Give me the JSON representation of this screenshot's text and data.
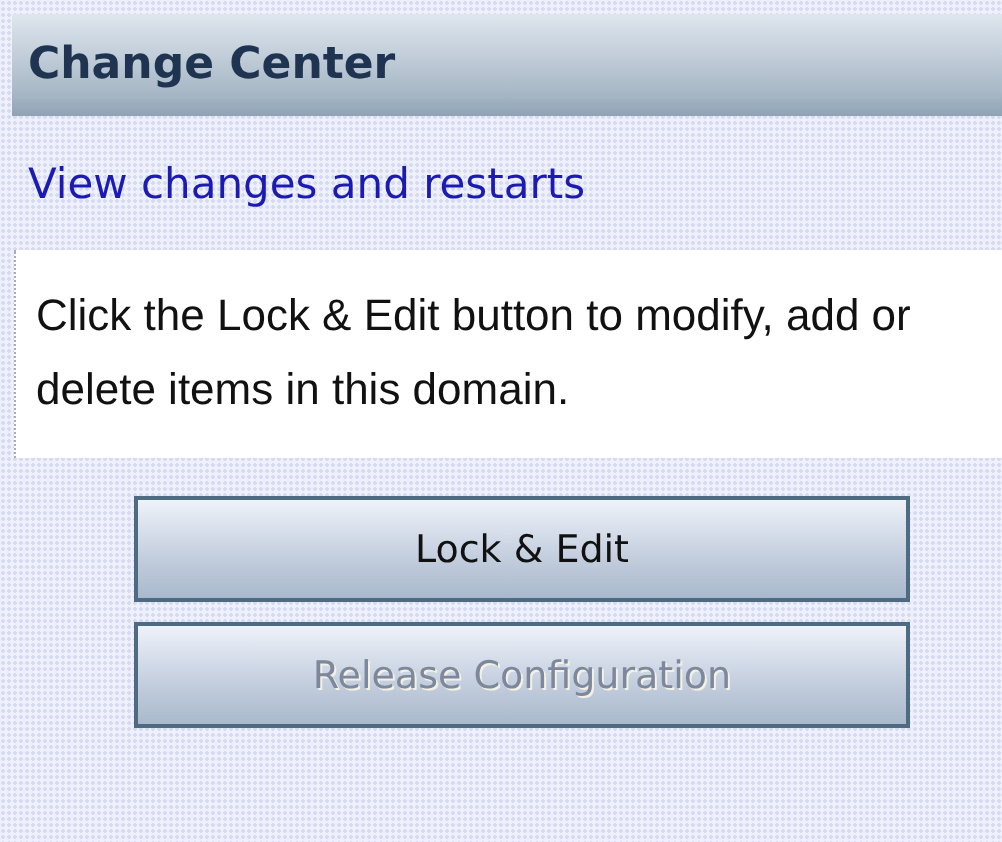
{
  "panel": {
    "title": "Change Center"
  },
  "link": "View changes and restarts",
  "message": "Click the Lock & Edit button to modify, add or delete items in this domain.",
  "buttons": [
    {
      "label": "Lock & Edit",
      "disabled": false
    },
    {
      "label": "Release Configuration",
      "disabled": true
    }
  ]
}
